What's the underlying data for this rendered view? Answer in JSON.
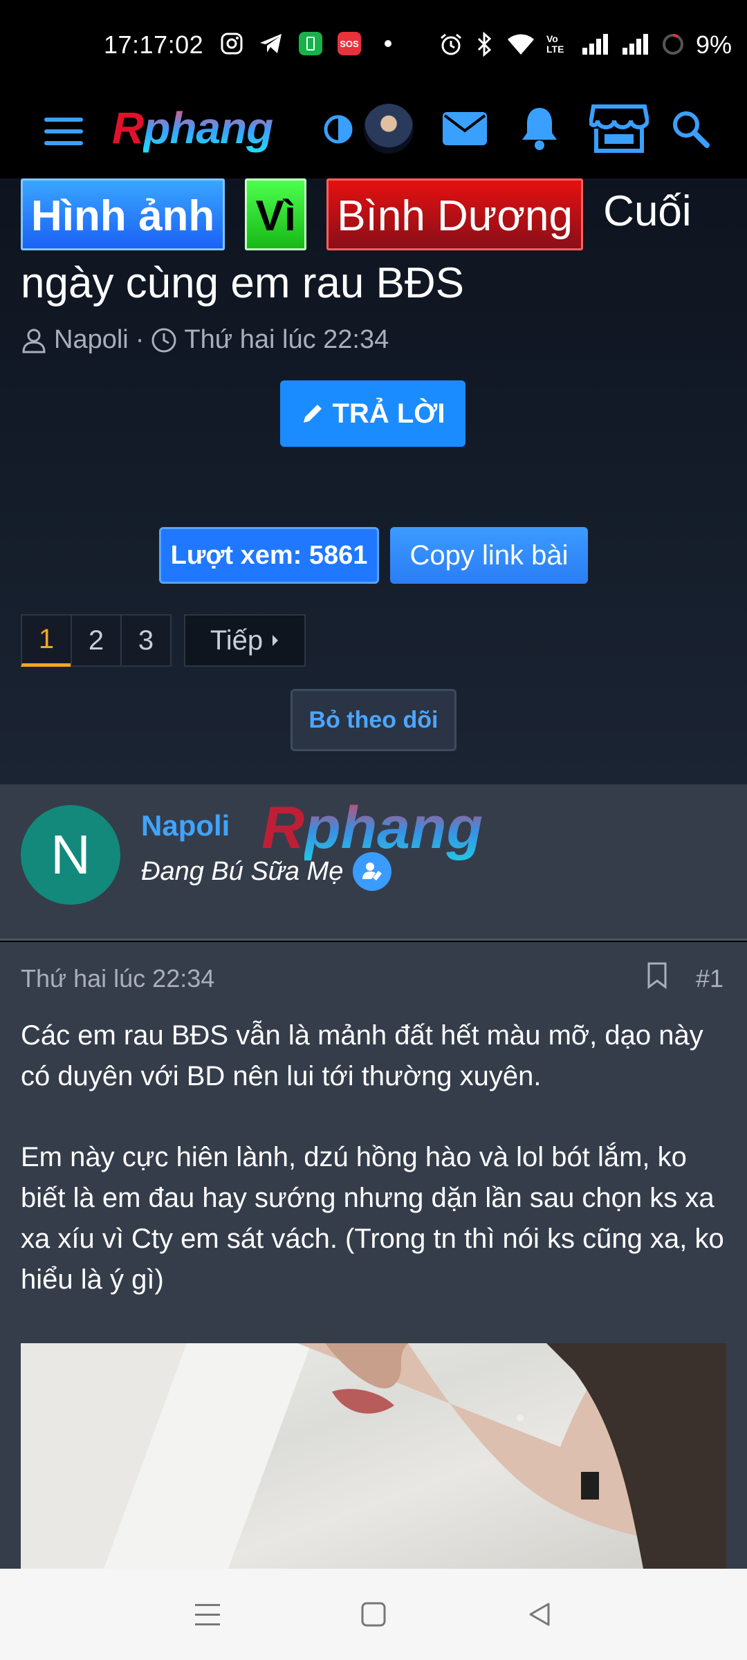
{
  "status_bar": {
    "time": "17:17:02",
    "battery": "9%",
    "icons": [
      "instagram-icon",
      "telegram-icon",
      "battery-saver-icon",
      "sos-icon",
      "dot-icon",
      "alarm-icon",
      "bluetooth-icon",
      "wifi-icon",
      "volte-icon",
      "signal-icon",
      "signal-icon-2",
      "battery-ring-icon"
    ],
    "sos_text": "SOS",
    "volte_text": "Vo LTE"
  },
  "header": {
    "logo_first": "R",
    "logo_rest": "phang",
    "icons": [
      "menu-icon",
      "theme-toggle-icon",
      "user-avatar",
      "mail-icon",
      "bell-icon",
      "store-icon",
      "search-icon"
    ],
    "accent": "#3aa0ff"
  },
  "thread": {
    "labels": [
      "Hình ảnh",
      "Vì",
      "Bình Dương"
    ],
    "title_tail": "Cuối",
    "title_line2": "ngày cùng em rau BĐS",
    "author": "Napoli",
    "separator": "·",
    "date": "Thứ hai lúc 22:34",
    "reply_label": "TRẢ LỜI",
    "views_label": "Lượt xem: 5861",
    "copy_label": "Copy link bài",
    "pages": [
      "1",
      "2",
      "3"
    ],
    "active_page": "1",
    "next_label": "Tiếp",
    "unfollow_label": "Bỏ theo dõi"
  },
  "author_block": {
    "avatar_letter": "N",
    "avatar_color": "#12897a",
    "name": "Napoli",
    "title": "Đang Bú Sữa Mẹ",
    "watermark_first": "R",
    "watermark_rest": "phang"
  },
  "post": {
    "date": "Thứ hai lúc 22:34",
    "number": "#1",
    "paragraph1": "Các em rau BĐS vẫn là mảnh đất hết màu mỡ, dạo này có duyên với BD nên lui tới thường xuyên.",
    "paragraph2": "Em này cực hiên lành, dzú hồng hào và lol bót lắm, ko biết là em đau hay sướng nhưng dặn lần sau chọn ks xa xa xíu vì Cty em sát vách. (Trong tn thì nói ks cũng xa, ko hiểu là ý gì)"
  },
  "nav_bar": {
    "icons": [
      "recent-apps-icon",
      "home-icon",
      "back-icon"
    ]
  }
}
